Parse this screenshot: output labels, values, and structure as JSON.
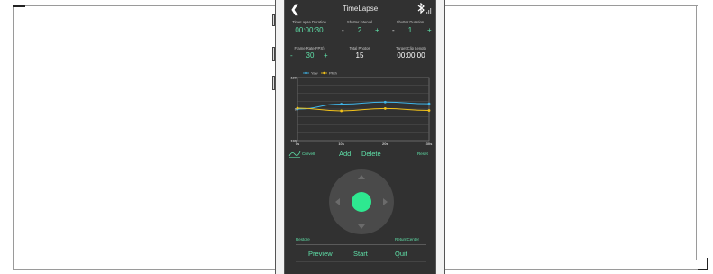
{
  "header": {
    "title": "TimeLapse",
    "back_icon": "chevron-left-icon",
    "status_icon": "bluetooth-signal-icon"
  },
  "settings": {
    "timelapse_duration": {
      "label": "TimeLapse Duration",
      "value": "00:00:30"
    },
    "shutter_interval": {
      "label": "Shutter interval",
      "minus": "-",
      "value": "2",
      "plus": "+"
    },
    "shutter_duration": {
      "label": "Shutter Duration",
      "minus": "-",
      "value": "1",
      "plus": "+"
    },
    "frame_rate": {
      "label": "Frame Rate(FPS)",
      "minus": "-",
      "value": "30",
      "plus": "+"
    },
    "total_photos": {
      "label": "Total Photos",
      "value": "15"
    },
    "target_clip_length": {
      "label": "Target Clip Length",
      "value": "00:00:00"
    }
  },
  "chart_data": {
    "type": "line",
    "x": [
      0,
      10,
      20,
      30
    ],
    "x_tick_labels": [
      "0s",
      "10s",
      "20s",
      "30s"
    ],
    "y_tick_labels": [
      "180",
      "0",
      "-180"
    ],
    "ylim": [
      -180,
      180
    ],
    "grid": true,
    "legend_position": "top-left",
    "series": [
      {
        "name": "Yaw",
        "color": "#3fb6ea",
        "values": [
          0,
          28,
          40,
          30
        ]
      },
      {
        "name": "Pitch",
        "color": "#f2c21a",
        "values": [
          5,
          -10,
          3,
          -8
        ]
      }
    ]
  },
  "actions": {
    "curve_label": "Curve8",
    "curve_icon": "curve-icon",
    "add": "Add",
    "delete": "Delete",
    "reset": "Reset"
  },
  "joystick": {
    "up_icon": "arrow-up-icon",
    "down_icon": "arrow-down-icon",
    "left_icon": "arrow-left-icon",
    "right_icon": "arrow-right-icon"
  },
  "footer": {
    "restore": "Restore",
    "return_center": "ReturnCenter",
    "preview": "Preview",
    "start": "Start",
    "quit": "Quit"
  },
  "colors": {
    "accent": "#5fe0a8",
    "knob": "#2ee890",
    "screen_bg": "#313131"
  }
}
